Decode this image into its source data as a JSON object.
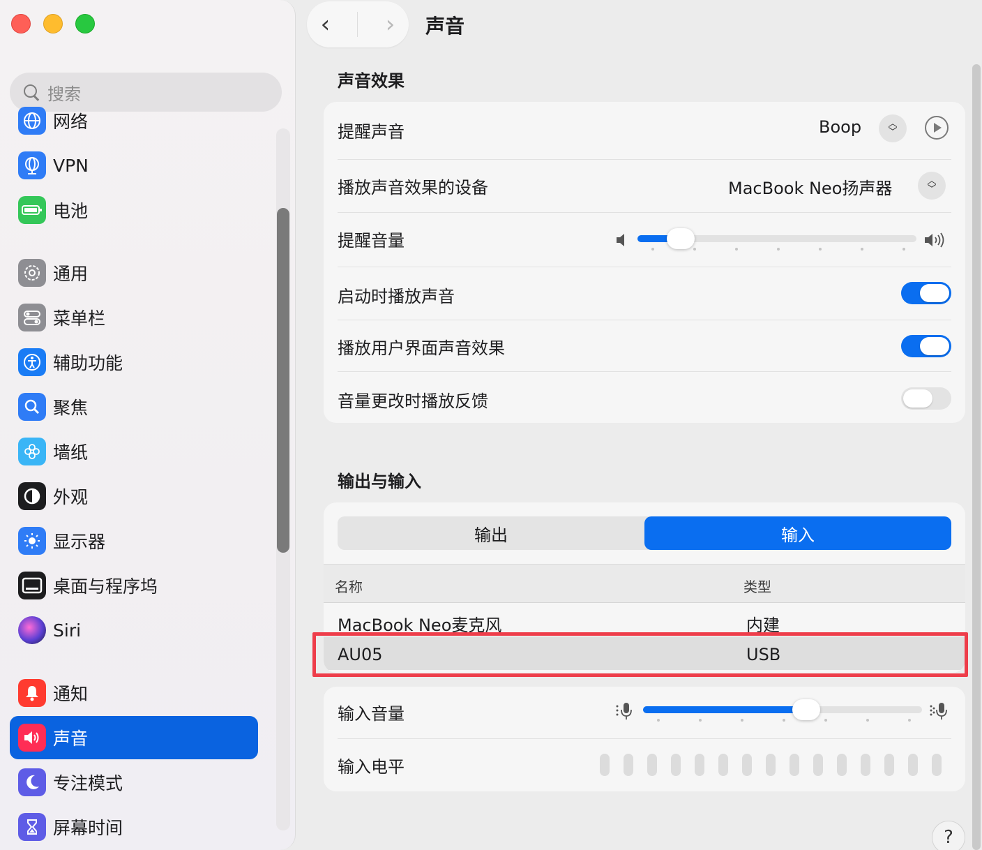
{
  "sidebar": {
    "search_placeholder": "搜索",
    "items": [
      {
        "label": "网络",
        "icon": "globe-icon",
        "color": "#2f7cf6"
      },
      {
        "label": "VPN",
        "icon": "vpn-globe-icon",
        "color": "#2f7cf6"
      },
      {
        "label": "电池",
        "icon": "battery-icon",
        "color": "#34c759"
      },
      {
        "label": "通用",
        "icon": "gear-icon",
        "color": "#8e8e93"
      },
      {
        "label": "菜单栏",
        "icon": "menubar-toggle-icon",
        "color": "#8e8e93"
      },
      {
        "label": "辅助功能",
        "icon": "accessibility-icon",
        "color": "#1a7cf5"
      },
      {
        "label": "聚焦",
        "icon": "spotlight-magnifier-icon",
        "color": "#2f7cf6"
      },
      {
        "label": "墙纸",
        "icon": "flower-wallpaper-icon",
        "color": "#3ab5f6"
      },
      {
        "label": "外观",
        "icon": "appearance-circle-icon",
        "color": "#1d1d1f"
      },
      {
        "label": "显示器",
        "icon": "sun-display-icon",
        "color": "#2f7cf6"
      },
      {
        "label": "桌面与程序坞",
        "icon": "dock-icon",
        "color": "#1d1d1f"
      },
      {
        "label": "Siri",
        "icon": "siri-orb-icon",
        "color": "#5b3fd3"
      },
      {
        "label": "通知",
        "icon": "bell-icon",
        "color": "#ff3b30"
      },
      {
        "label": "声音",
        "icon": "speaker-icon",
        "color": "#ff2d55"
      },
      {
        "label": "专注模式",
        "icon": "moon-icon",
        "color": "#5e5ce6"
      },
      {
        "label": "屏幕时间",
        "icon": "hourglass-icon",
        "color": "#5e5ce6"
      }
    ],
    "selected": "声音"
  },
  "header": {
    "title": "声音",
    "back": "‹",
    "forward": "›"
  },
  "sound_effects": {
    "section_title": "声音效果",
    "alert_sound_label": "提醒声音",
    "alert_sound_value": "Boop",
    "output_device_label": "播放声音效果的设备",
    "output_device_value": "MacBook Neo扬声器",
    "alert_volume_label": "提醒音量",
    "alert_volume_level": 0.155,
    "startup_sound_label": "启动时播放声音",
    "startup_sound_on": true,
    "ui_sound_label": "播放用户界面声音效果",
    "ui_sound_on": true,
    "volume_feedback_label": "音量更改时播放反馈",
    "volume_feedback_on": false
  },
  "io": {
    "section_title": "输出与输入",
    "tabs": [
      "输出",
      "输入"
    ],
    "active_tab": "输入",
    "columns": [
      "名称",
      "类型"
    ],
    "devices": [
      {
        "name": "MacBook Neo麦克风",
        "type": "内建"
      },
      {
        "name": "AU05",
        "type": "USB"
      }
    ],
    "selected_device": "AU05",
    "input_volume_label": "输入音量",
    "input_volume_level": 0.585,
    "input_level_label": "输入电平",
    "input_level_bars": 15
  },
  "help": "?",
  "colors": {
    "accent": "#0a6ef0",
    "highlight": "#ee3d4a"
  }
}
